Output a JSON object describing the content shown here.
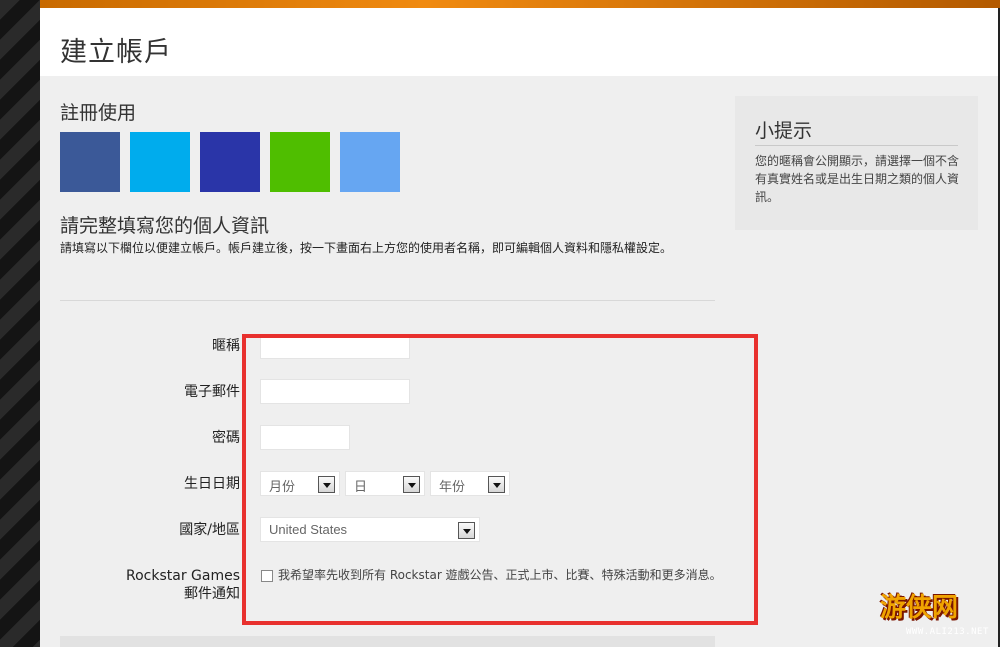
{
  "header": {
    "title": "建立帳戶"
  },
  "register": {
    "title": "註冊使用",
    "social_buttons": [
      {
        "name": "social-button-1",
        "color": "#3b5998"
      },
      {
        "name": "social-button-2",
        "color": "#00aced"
      },
      {
        "name": "social-button-3",
        "color": "#2a35a8"
      },
      {
        "name": "social-button-4",
        "color": "#4fbe00"
      },
      {
        "name": "social-button-5",
        "color": "#66a6f2"
      }
    ]
  },
  "info": {
    "title": "請完整填寫您的個人資訊",
    "description": "請填寫以下欄位以便建立帳戶。帳戶建立後，按一下畫面右上方您的使用者名稱，即可編輯個人資料和隱私權設定。"
  },
  "form": {
    "nickname_label": "暱稱",
    "nickname_value": "",
    "email_label": "電子郵件",
    "email_value": "",
    "password_label": "密碼",
    "password_value": "",
    "birthday_label": "生日日期",
    "month_value": "月份",
    "day_value": "日",
    "year_value": "年份",
    "country_label": "國家/地區",
    "country_value": "United States",
    "notify_label_line1": "Rockstar Games",
    "notify_label_line2": "郵件通知",
    "notify_text": "我希望率先收到所有 Rockstar 遊戲公告、正式上市、比賽、特殊活動和更多消息。"
  },
  "tips": {
    "title": "小提示",
    "text": "您的暱稱會公開顯示，請選擇一個不含有真實姓名或是出生日期之類的個人資訊。"
  },
  "watermark": {
    "logo": "游侠网",
    "url": "WWW.ALI213.NET"
  },
  "colors": {
    "highlight": "#e8302e",
    "accent": "#f08a10"
  }
}
